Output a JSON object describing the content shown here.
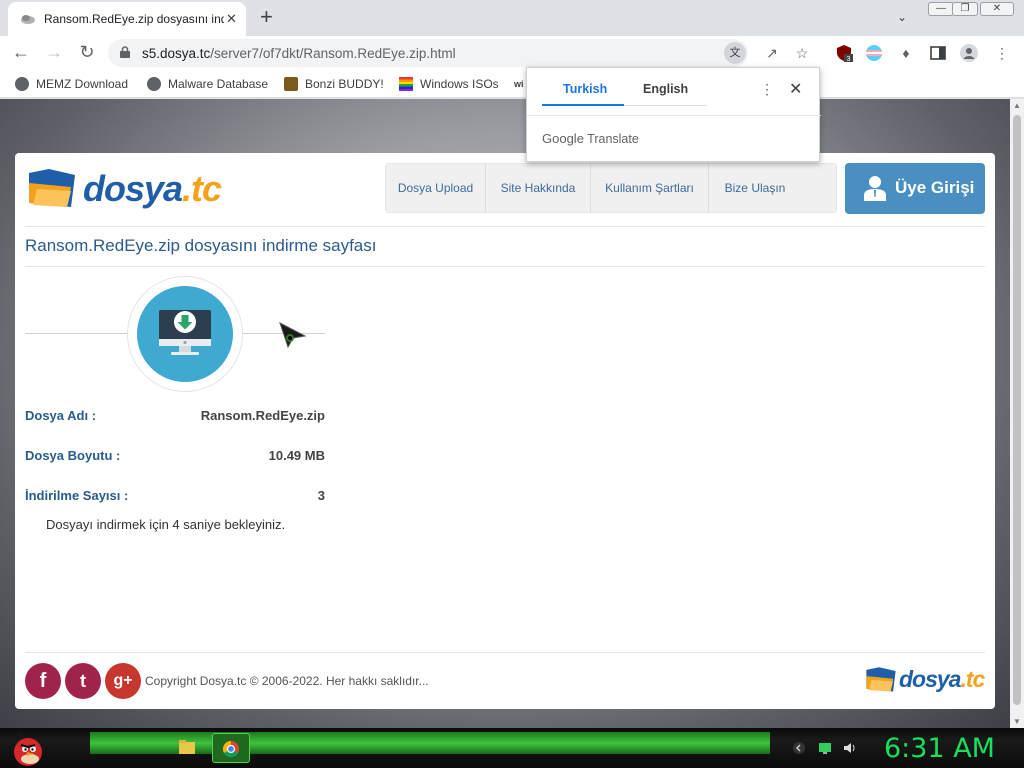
{
  "browser": {
    "tab_title": "Ransom.RedEye.zip dosyasını ind",
    "tab_close": "✕",
    "new_tab": "+",
    "url_host": "s5.dosya.tc",
    "url_path": "/server7/of7dkt/Ransom.RedEye.zip.html",
    "extension_badge": "3",
    "bookmarks": [
      "MEMZ Download",
      "Malware Database",
      "Bonzi BUDDY!",
      "Windows ISOs",
      "wi"
    ]
  },
  "translate_popup": {
    "tab_source": "Turkish",
    "tab_target": "English",
    "brand_google": "Google",
    "brand_translate": "Translate",
    "close": "✕",
    "more": "⋮"
  },
  "site": {
    "logo_main": "dosya",
    "logo_tld": ".tc",
    "nav": [
      "Dosya Upload",
      "Site Hakkında",
      "Kullanım Şartları",
      "Bize Ulaşın"
    ],
    "login_label": "Üye Girişi",
    "page_title": "Ransom.RedEye.zip dosyasını indirme sayfası",
    "file_name_label": "Dosya Adı :",
    "file_name_value": "Ransom.RedEye.zip",
    "file_size_label": "Dosya Boyutu :",
    "file_size_value": "10.49 MB",
    "download_count_label": "İndirilme Sayısı :",
    "download_count_value": "3",
    "wait_message": "Dosyayı indirmek için 4 saniye bekleyiniz.",
    "copyright": "Copyright Dosya.tc © 2006-2022. Her hakkı saklıdır...",
    "social": [
      "f",
      "t",
      "g+"
    ]
  },
  "taskbar": {
    "clock": "6:31 AM"
  },
  "colors": {
    "accent": "#2b5b8e",
    "logo_orange": "#f4a21e",
    "download_circle": "#3fa9d0",
    "login_button": "#4a8fc1",
    "clock_green": "#18e05a",
    "facebook": "#a0234b",
    "twitter": "#a0234b",
    "gplus": "#c8372d"
  }
}
